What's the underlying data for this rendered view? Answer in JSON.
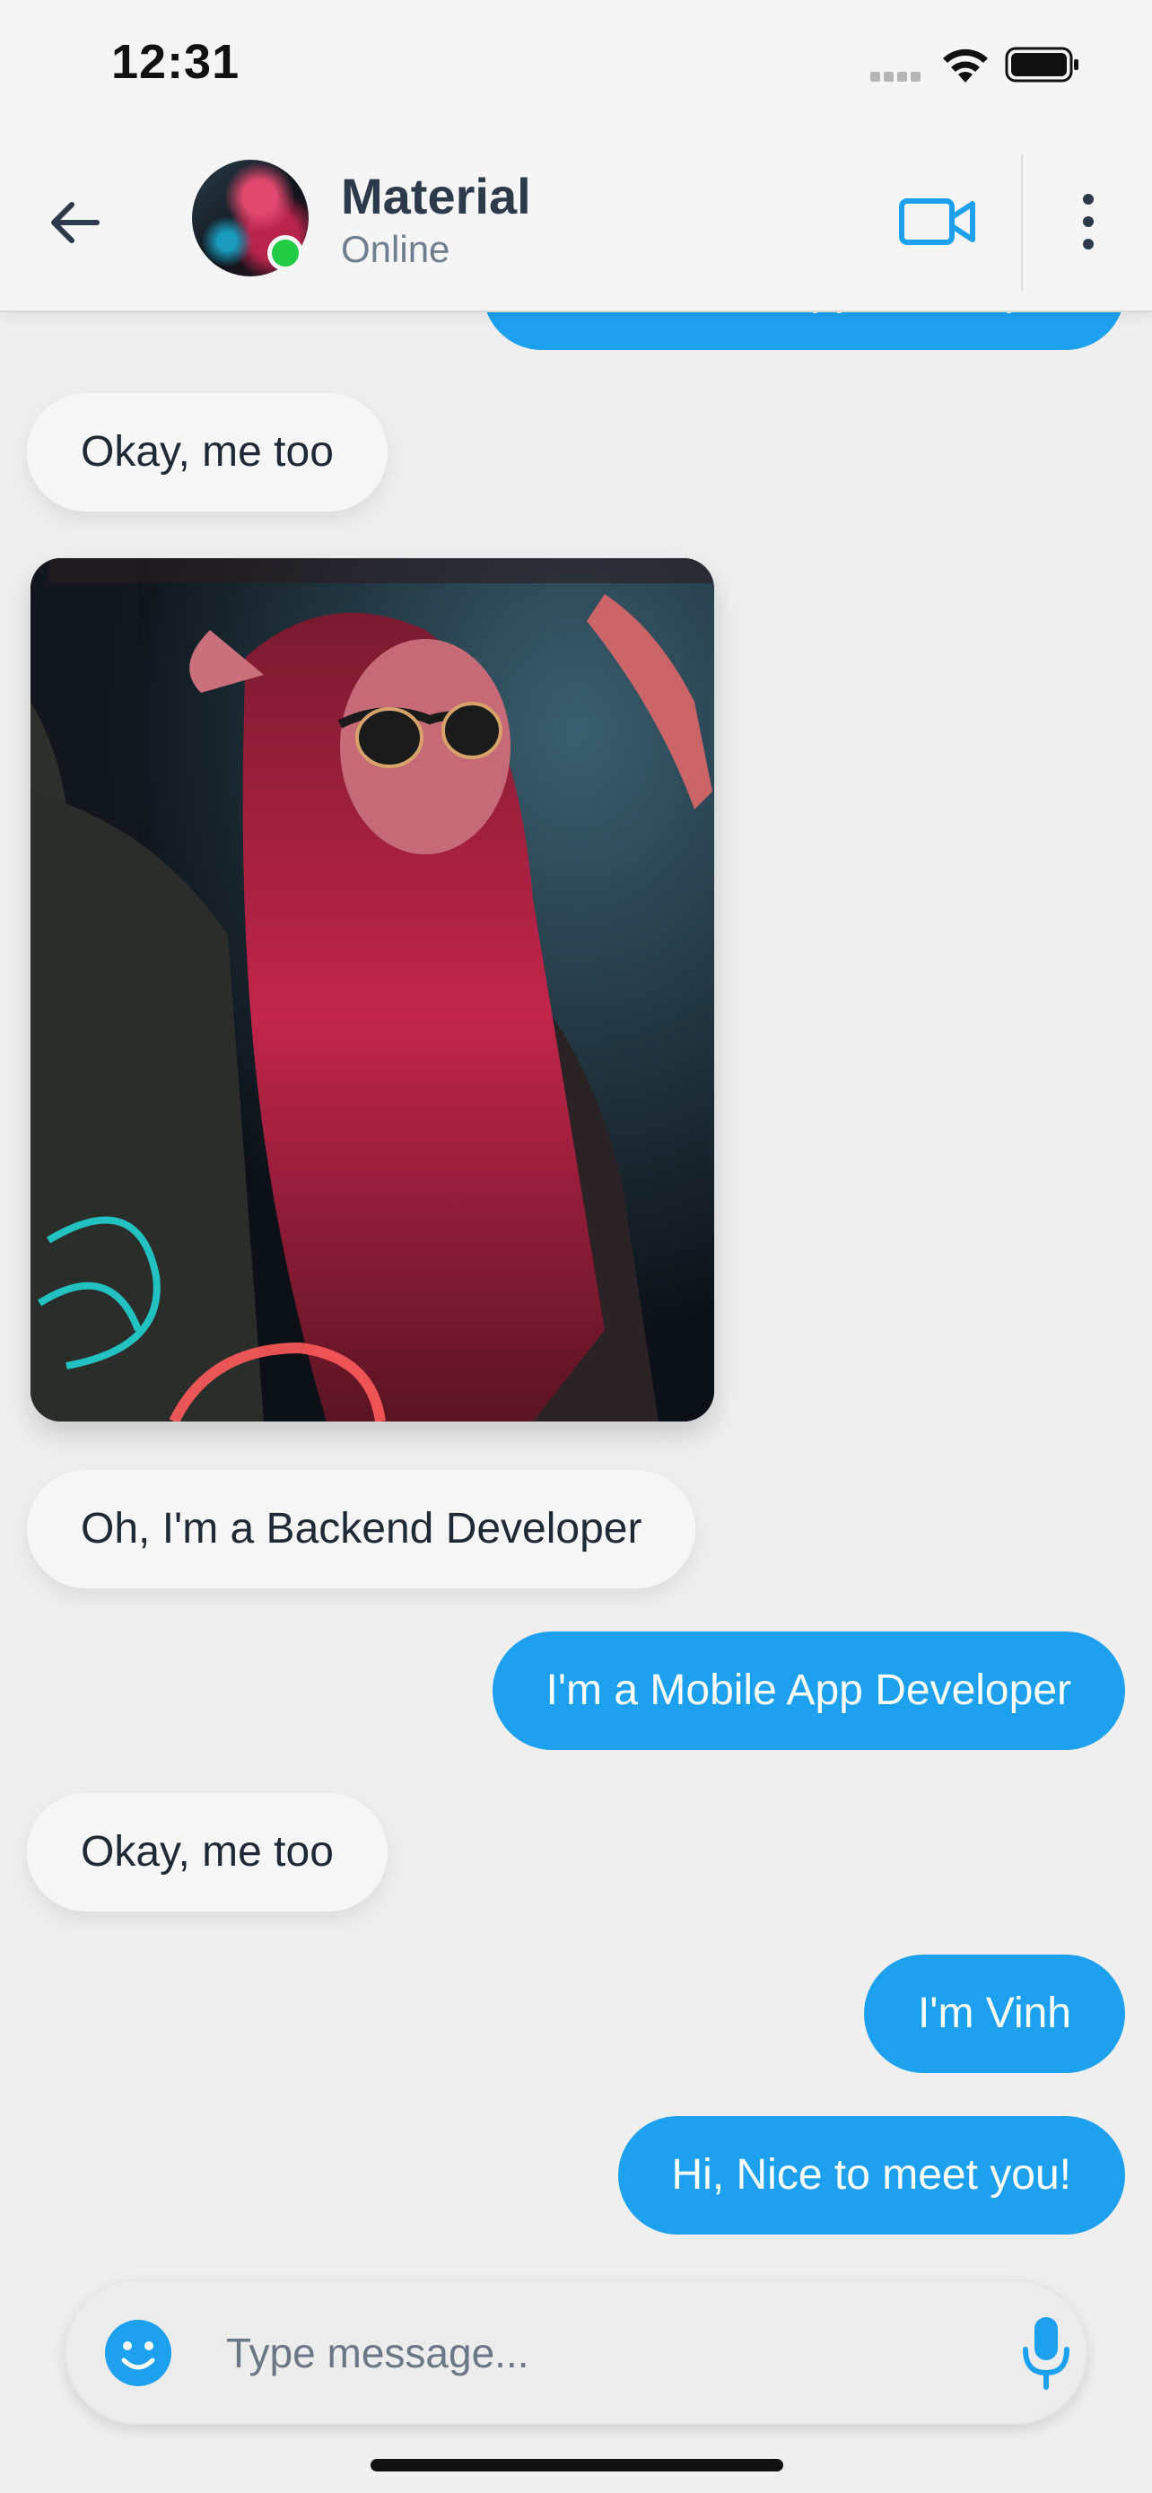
{
  "status_bar": {
    "time": "12:31"
  },
  "header": {
    "contact_name": "Material",
    "contact_status": "Online"
  },
  "messages": [
    {
      "side": "out",
      "text": "I'm a Mobile App Developer",
      "partially_visible": true
    },
    {
      "side": "in",
      "text": "Okay, me too"
    },
    {
      "side": "in",
      "type": "image",
      "alt": "photo"
    },
    {
      "side": "in",
      "text": "Oh, I'm a Backend Developer"
    },
    {
      "side": "out",
      "text": "I'm a Mobile App Developer"
    },
    {
      "side": "in",
      "text": "Okay, me too"
    },
    {
      "side": "out",
      "text": "I'm Vinh"
    },
    {
      "side": "out",
      "text": "Hi, Nice to meet you!"
    }
  ],
  "composer": {
    "placeholder": "Type message...",
    "value": ""
  },
  "icons": {
    "back": "arrow-left-icon",
    "video": "video-camera-icon",
    "more": "more-vertical-icon",
    "emoji": "emoji-icon",
    "mic": "microphone-icon"
  },
  "colors": {
    "accent": "#1da1ef",
    "online": "#22cc44",
    "incoming_bubble": "#f6f6f6",
    "background": "#efefef"
  }
}
